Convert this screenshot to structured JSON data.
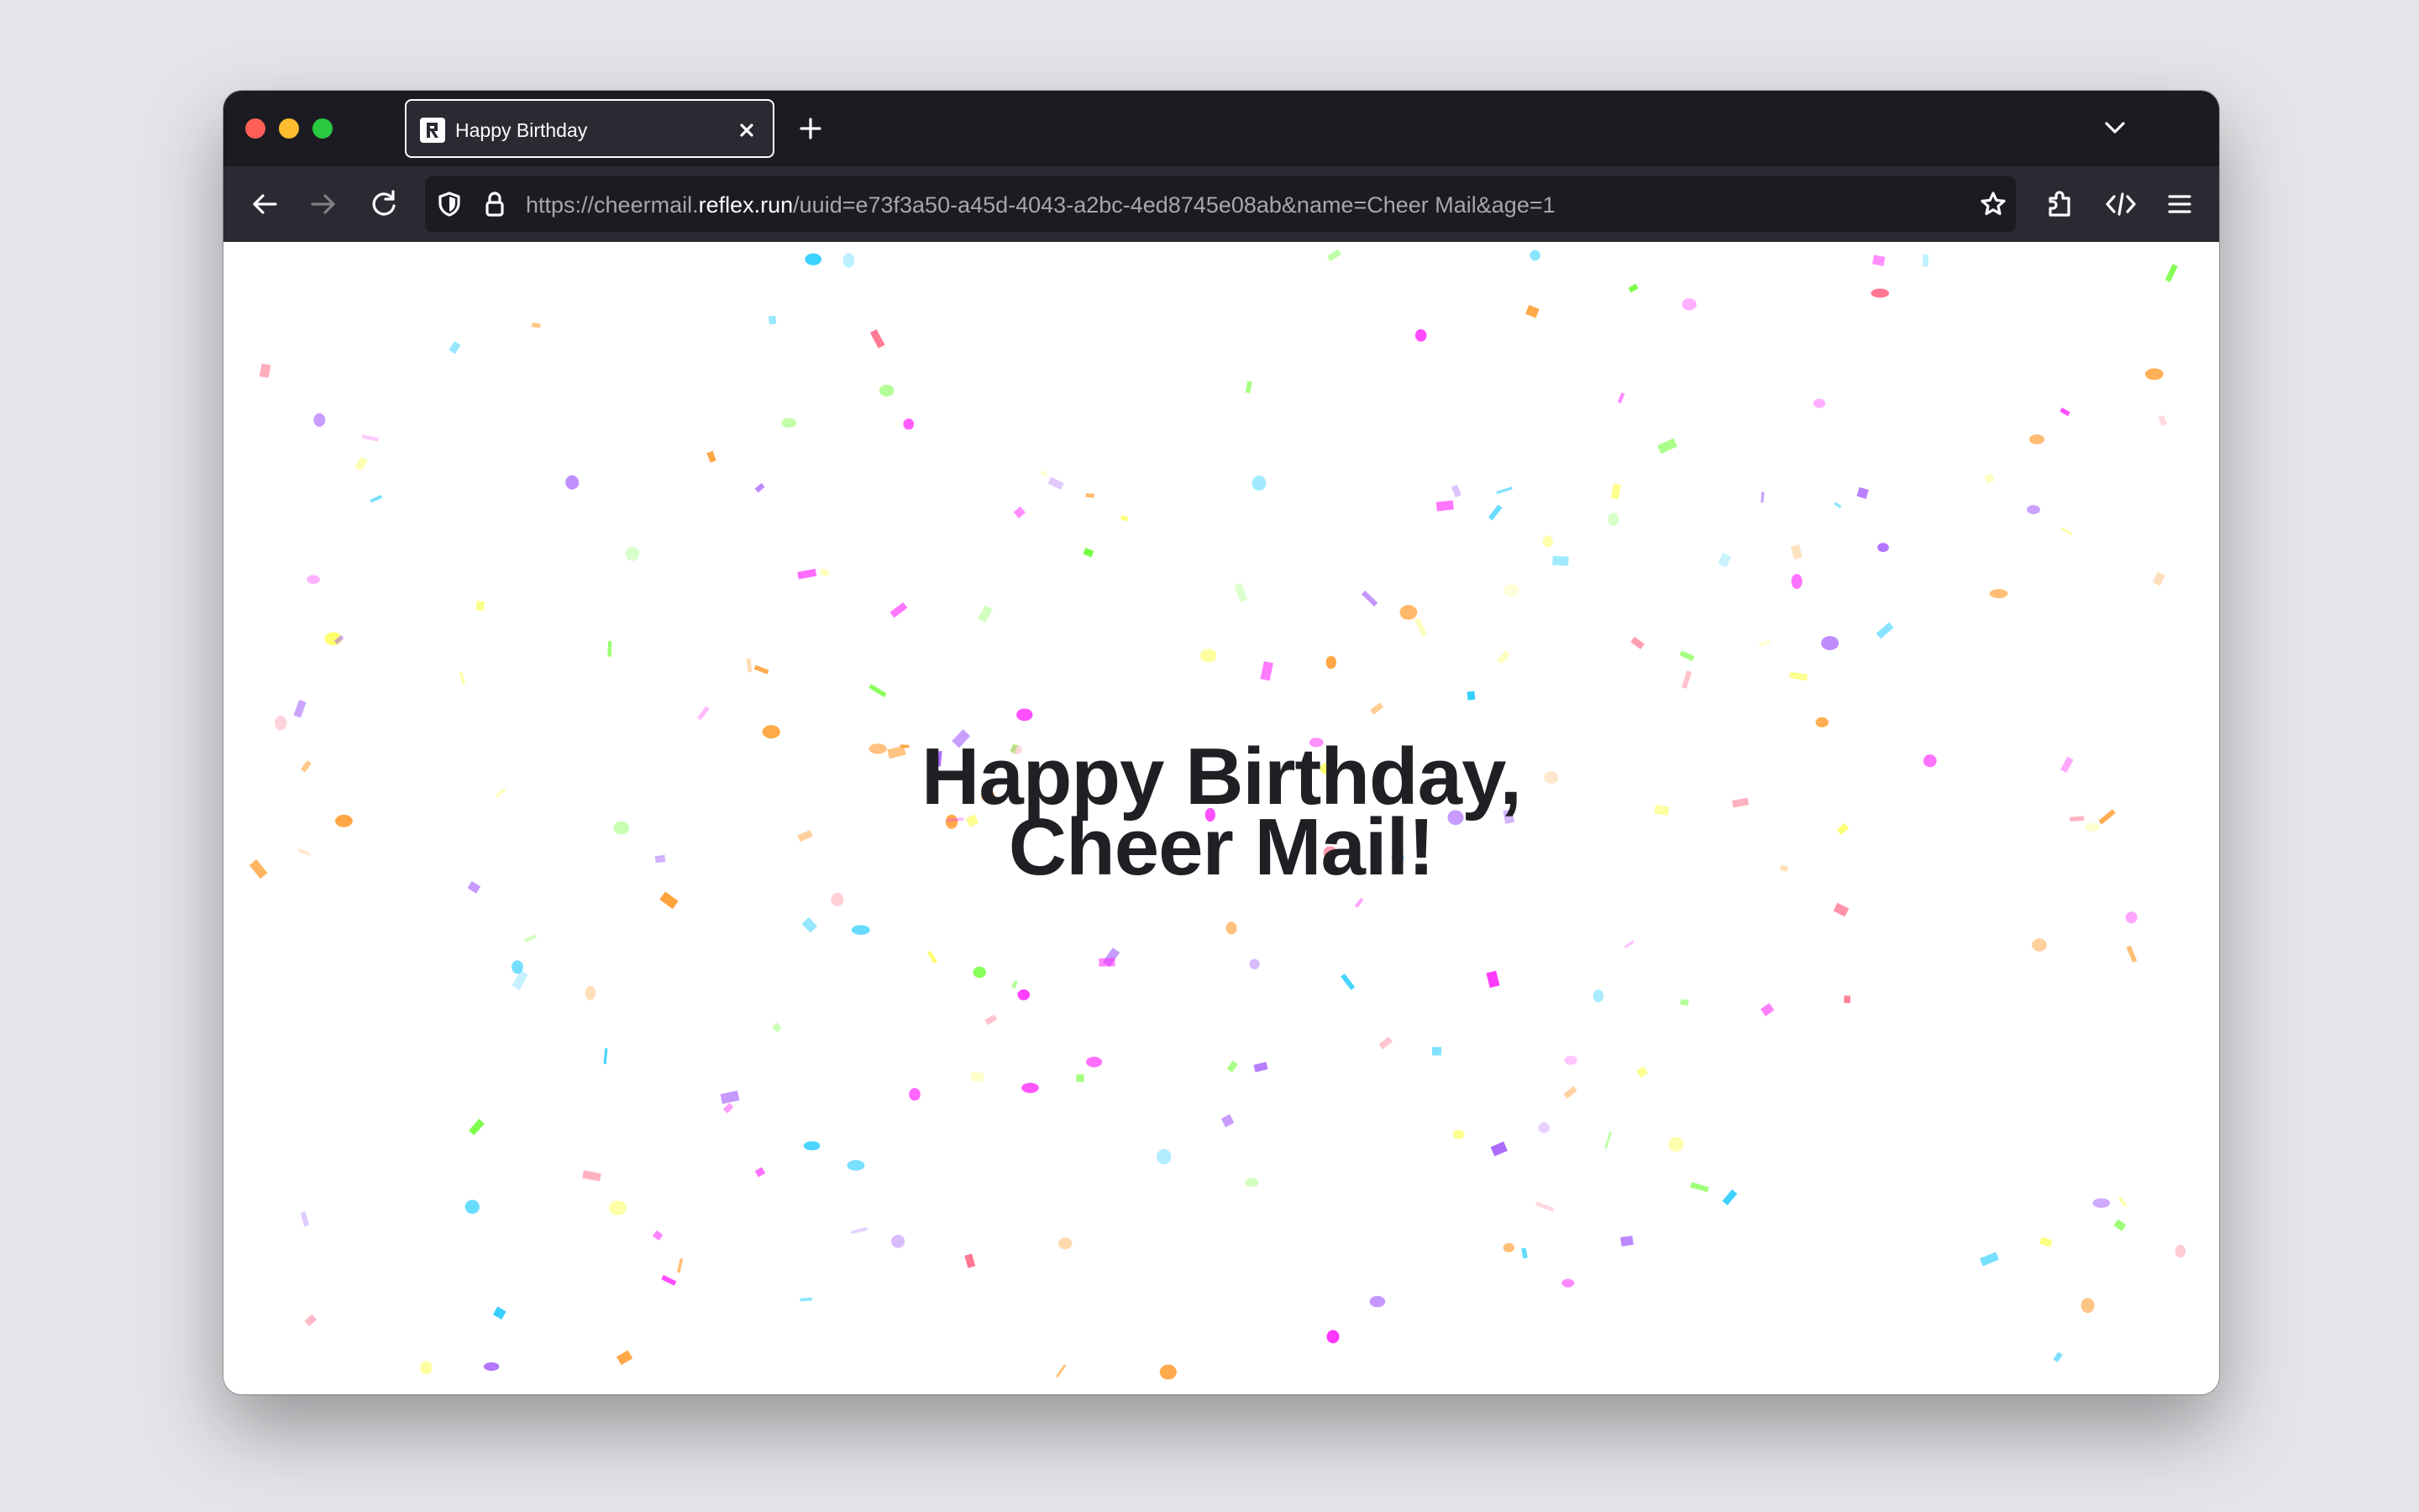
{
  "browser": {
    "tab": {
      "title": "Happy Birthday",
      "favicon": "reflex-logo-icon"
    },
    "url": {
      "prefix": "https://cheermail.",
      "host": "reflex.run",
      "path": "/uuid=e73f3a50-a45d-4043-a2bc-4ed8745e08ab&name=Cheer Mail&age=1"
    },
    "toolbar_icons": [
      "back-arrow-icon",
      "forward-arrow-icon",
      "reload-icon",
      "tracking-shield-icon",
      "lock-icon",
      "bookmark-star-icon",
      "extensions-icon",
      "developer-tools-icon",
      "hamburger-menu-icon"
    ],
    "colors": {
      "titlebar": "#1c1b22",
      "toolbar": "#2b2a33",
      "urlbar": "#1c1b22",
      "traffic_close": "#ff5f57",
      "traffic_minimize": "#febc2e",
      "traffic_maximize": "#28c840"
    }
  },
  "page": {
    "greeting_line1": "Happy Birthday,",
    "greeting_line2": "Cheer Mail!",
    "text_color": "#1f1f24",
    "background": "#ffffff",
    "confetti_palette": [
      "#a864fd",
      "#29cdff",
      "#78ff44",
      "#ff718d",
      "#fdff6a",
      "#ff36ff",
      "#ffa23a"
    ]
  }
}
